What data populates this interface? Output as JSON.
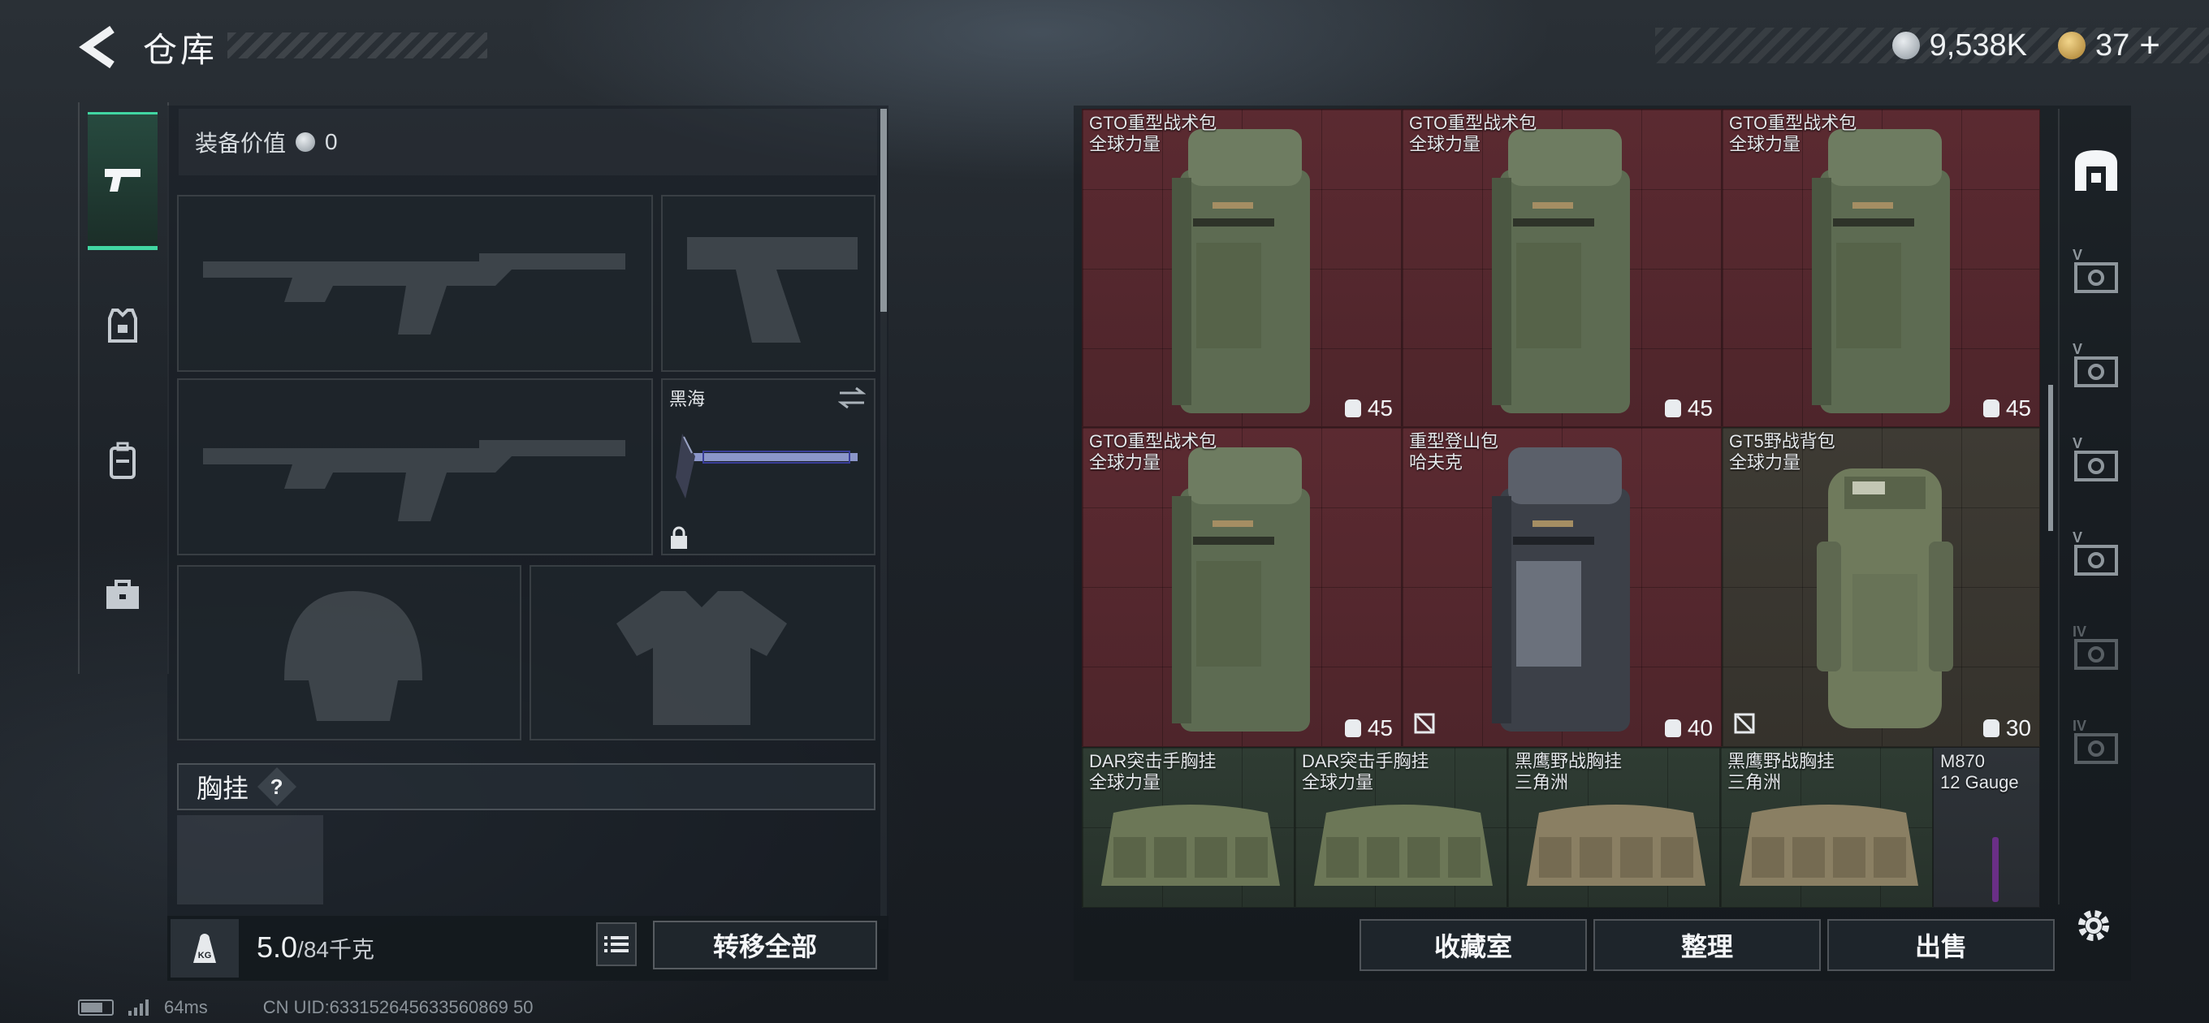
{
  "header": {
    "title": "仓库",
    "currency_silver": "9,538K",
    "currency_gold": "37",
    "plus_label": "+"
  },
  "equipment": {
    "value_label": "装备价值",
    "value": "0",
    "melee_name": "黑海",
    "chest_rig_label": "胸挂",
    "help_label": "?"
  },
  "weight": {
    "kg_icon_label": "KG",
    "current": "5.0",
    "max": "/84千克"
  },
  "actions": {
    "transfer_all": "转移全部",
    "collection": "收藏室",
    "organize": "整理",
    "sell": "出售"
  },
  "storage_items": [
    {
      "name": "GTO重型战术包",
      "brand": "全球力量",
      "capacity": "45",
      "color": "red"
    },
    {
      "name": "GTO重型战术包",
      "brand": "全球力量",
      "capacity": "45",
      "color": "red"
    },
    {
      "name": "GTO重型战术包",
      "brand": "全球力量",
      "capacity": "45",
      "color": "red"
    },
    {
      "name": "GTO重型战术包",
      "brand": "全球力量",
      "capacity": "45",
      "color": "red"
    },
    {
      "name": "重型登山包",
      "brand": "哈夫克",
      "capacity": "40",
      "color": "red"
    },
    {
      "name": "GT5野战背包",
      "brand": "全球力量",
      "capacity": "30",
      "color": "olive"
    },
    {
      "name": "DAR突击手胸挂",
      "brand": "全球力量",
      "color": "green"
    },
    {
      "name": "DAR突击手胸挂",
      "brand": "全球力量",
      "color": "green"
    },
    {
      "name": "黑鹰野战胸挂",
      "brand": "三角洲",
      "color": "green"
    },
    {
      "name": "黑鹰野战胸挂",
      "brand": "三角洲",
      "color": "green"
    },
    {
      "name": "M870",
      "brand": "12 Gauge",
      "color": "gray"
    }
  ],
  "filter_tabs": [
    {
      "icon": "storage-icon"
    },
    {
      "roman": "V",
      "icon": "safe-icon"
    },
    {
      "roman": "V",
      "icon": "safe-icon"
    },
    {
      "roman": "V",
      "icon": "safe-icon"
    },
    {
      "roman": "V",
      "icon": "safe-icon"
    },
    {
      "roman": "IV",
      "icon": "safe-icon"
    },
    {
      "roman": "IV",
      "icon": "safe-icon"
    }
  ],
  "footer": {
    "ping": "64ms",
    "uid": "CN UID:633152645633560869 50"
  },
  "colors": {
    "accent": "#41d6a2",
    "cell_red": "#5b2a31",
    "cell_olive": "#3e3b34",
    "cell_green": "#2f3c33"
  }
}
